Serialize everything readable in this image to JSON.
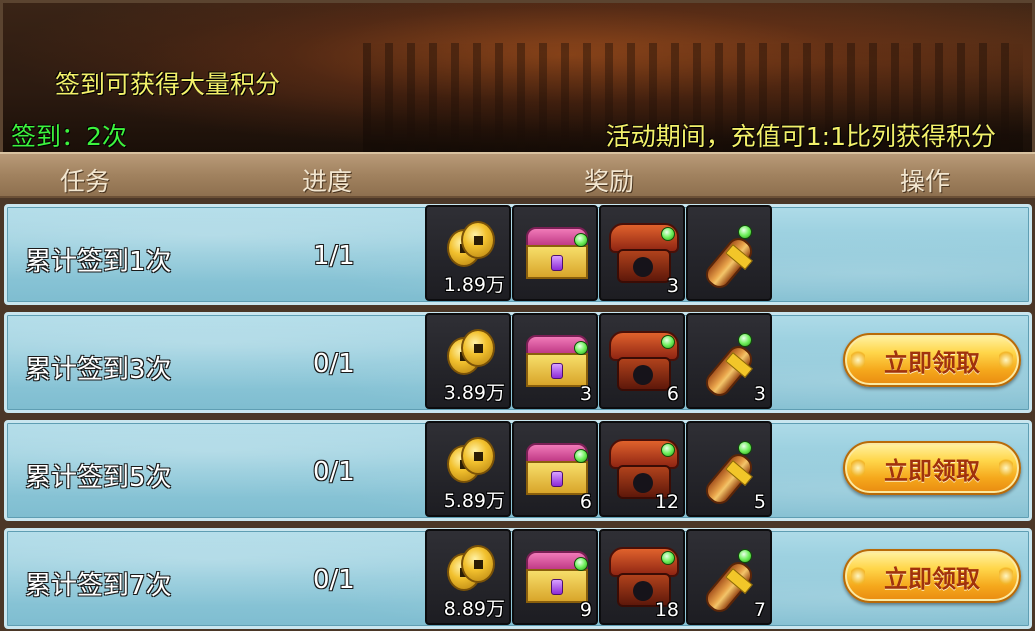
{
  "banner": {
    "title": "签到可获得大量积分",
    "signin_count": "签到：2次",
    "recharge_note": "活动期间，充值可1:1比列获得积分"
  },
  "header": {
    "task": "任务",
    "progress": "进度",
    "reward": "奖励",
    "action": "操作"
  },
  "rows": [
    {
      "name": "累计签到1次",
      "progress": "1/1",
      "rewards": [
        {
          "icon": "copper-coins-icon",
          "qty": "1.89万"
        },
        {
          "icon": "treasure-chest-icon",
          "qty": ""
        },
        {
          "icon": "red-box-icon",
          "qty": "3"
        },
        {
          "icon": "scroll-icon",
          "qty": ""
        }
      ],
      "button": ""
    },
    {
      "name": "累计签到3次",
      "progress": "0/1",
      "rewards": [
        {
          "icon": "copper-coins-icon",
          "qty": "3.89万"
        },
        {
          "icon": "treasure-chest-icon",
          "qty": "3"
        },
        {
          "icon": "red-box-icon",
          "qty": "6"
        },
        {
          "icon": "scroll-icon",
          "qty": "3"
        }
      ],
      "button": "立即领取"
    },
    {
      "name": "累计签到5次",
      "progress": "0/1",
      "rewards": [
        {
          "icon": "copper-coins-icon",
          "qty": "5.89万"
        },
        {
          "icon": "treasure-chest-icon",
          "qty": "6"
        },
        {
          "icon": "red-box-icon",
          "qty": "12"
        },
        {
          "icon": "scroll-icon",
          "qty": "5"
        }
      ],
      "button": "立即领取"
    },
    {
      "name": "累计签到7次",
      "progress": "0/1",
      "rewards": [
        {
          "icon": "copper-coins-icon",
          "qty": "8.89万"
        },
        {
          "icon": "treasure-chest-icon",
          "qty": "9"
        },
        {
          "icon": "red-box-icon",
          "qty": "18"
        },
        {
          "icon": "scroll-icon",
          "qty": "7"
        }
      ],
      "button": "立即领取"
    }
  ],
  "colors": {
    "title_yellow": "#f3f06a",
    "count_green": "#3df23d",
    "row_blue": "#8fc9da",
    "button_gold": "#ffd64a",
    "button_text": "#a1320c"
  }
}
